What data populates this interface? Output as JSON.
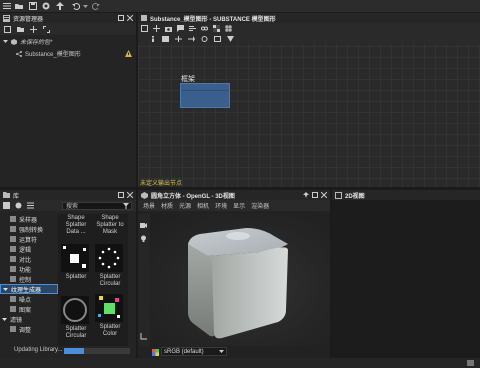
{
  "toolbar": {
    "icons": [
      "menu-icon",
      "folder-icon",
      "save-icon",
      "package-icon",
      "publish-icon",
      "undo-icon",
      "redo-icon"
    ]
  },
  "explorer": {
    "title": "资源管理器",
    "package": "未保存的包*",
    "graph_item": "Substance_模型图形"
  },
  "graph": {
    "title": "Substance_模型图形 - SUBSTANCE 模型图形",
    "node_label": "框架",
    "warning_text": "未定义输出节点"
  },
  "library": {
    "title": "库",
    "search_placeholder": "搜索",
    "categories_top": [
      "采样器",
      "强制转换",
      "运算符",
      "逻辑",
      "对比",
      "功能",
      "控制"
    ],
    "section_selected": "纹理生成器",
    "section_selected_children": [
      "噪点",
      "图案"
    ],
    "section_filter": "滤镜",
    "section_filter_children": [
      "调整"
    ],
    "thumbs": [
      {
        "label": "Shape Splatter Data ..."
      },
      {
        "label": "Shape Splatter to Mask"
      },
      {
        "label": "Splatter"
      },
      {
        "label": "Splatter Circular"
      },
      {
        "label": "Splatter Circular"
      },
      {
        "label": "Splatter Color"
      }
    ]
  },
  "status": {
    "text": "Updating Library...",
    "progress": 0.3
  },
  "view3d": {
    "title": "圆角立方体 - OpenGL - 3D视图",
    "menu": [
      "场景",
      "材质",
      "光源",
      "相机",
      "环境",
      "显示",
      "渲染器"
    ],
    "color_space": "sRGB (default)"
  },
  "view2d": {
    "title": "2D视图"
  },
  "colors": {
    "accent": "#4a8fd8",
    "node": "#3a5f8c",
    "warning": "#d6c44a"
  }
}
